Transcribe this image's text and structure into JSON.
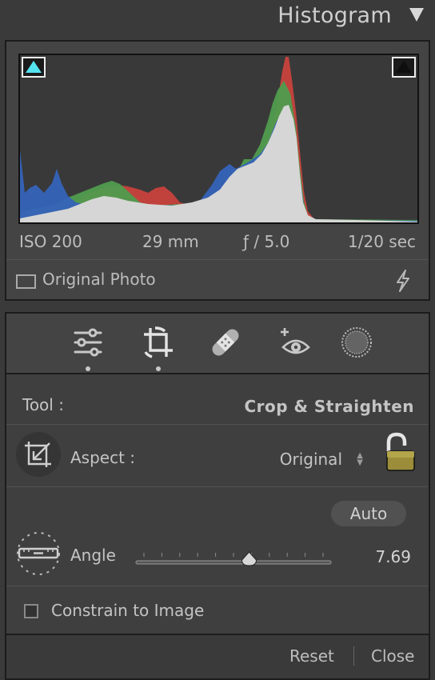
{
  "header": {
    "title": "Histogram"
  },
  "histogram": {
    "exif": {
      "iso": "ISO 200",
      "focal_length": "29 mm",
      "aperture": "ƒ / 5.0",
      "shutter": "1/20 sec"
    },
    "original_photo_label": "Original Photo",
    "clip_left_color": "#55e2f0",
    "clip_right_color": "#0e0e0e",
    "channel_colors": {
      "red": "#c8423c",
      "green": "#4f9c4e",
      "blue": "#3563b9",
      "luminance": "#d6d6d6"
    }
  },
  "tool_strip": {
    "tools": [
      {
        "icon": "sliders-icon",
        "has_dot": true
      },
      {
        "icon": "crop-rotate-icon",
        "has_dot": true,
        "selected": true
      },
      {
        "icon": "bandage-icon",
        "has_dot": false
      },
      {
        "icon": "red-eye-icon",
        "has_dot": false
      },
      {
        "icon": "radial-mask-icon",
        "has_dot": false
      }
    ]
  },
  "crop_panel": {
    "tool_label": "Tool :",
    "tool_value": "Crop & Straighten",
    "aspect_label": "Aspect :",
    "aspect_value": "Original",
    "aspect_locked": false,
    "auto_label": "Auto",
    "angle_label": "Angle",
    "angle_value": "7.69",
    "angle_slider_fraction": 0.58,
    "constrain_label": "Constrain to Image",
    "constrain_checked": false,
    "reset_label": "Reset",
    "close_label": "Close"
  }
}
